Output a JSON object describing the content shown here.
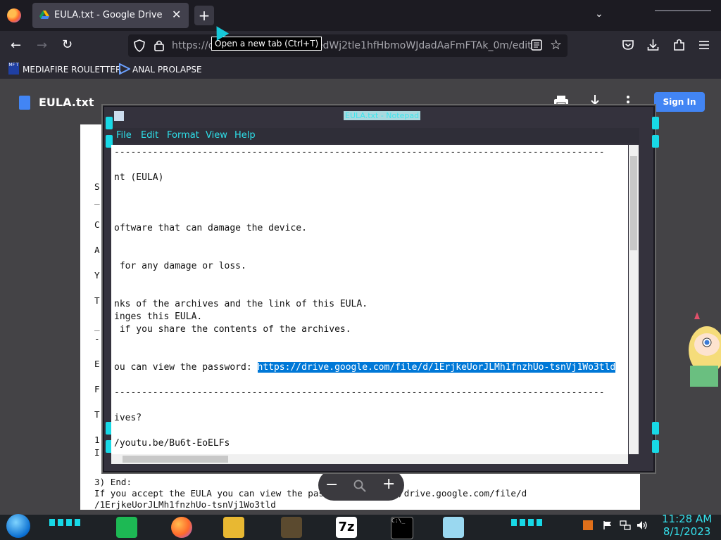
{
  "browser": {
    "tab_title": "EULA.txt - Google Drive",
    "tab_close": "✕",
    "new_tab": "+",
    "tabs_list": "⌄",
    "url_prefix": "https://d",
    "url_suffix": "5edWj2tle1hfHbmoWJdadAaFmFTAk_0m/edit",
    "tooltip": "Open a new tab (Ctrl+T)",
    "nav": {
      "back": "←",
      "forward": "→",
      "reload": "↻"
    },
    "bookmarks": [
      {
        "badge": "MF T",
        "label": "MEDIAFIRE ROULETTER"
      },
      {
        "badge": "",
        "label": "ANAL PROLAPSE"
      }
    ]
  },
  "drive": {
    "file_title": "EULA.txt",
    "sign_in": "Sign In",
    "zoom": {
      "minus": "−",
      "plus": "+"
    },
    "paper_lines": [
      "If you accept the EULA you can view the password: https://drive.google.com/file/d",
      "/1ErjkeUorJLMh1fnzhUo-tsnVj1Wo3tld"
    ],
    "paper_heading": "3) End:",
    "left_edge_chars": [
      "S",
      "_",
      "-",
      "C",
      "A",
      "Y",
      "T",
      "_",
      "-",
      "E",
      "F",
      "T",
      "1",
      "I"
    ]
  },
  "notepad": {
    "title": "EULA.txt - Notepad",
    "menu": [
      "File",
      "Edit",
      "Format",
      "View",
      "Help"
    ],
    "lines": [
      "-----------------------------------------------------------------------------------------",
      "",
      "nt (EULA)",
      "",
      "",
      "",
      "oftware that can damage the device.",
      "",
      "",
      " for any damage or loss.",
      "",
      "",
      "nks of the archives and the link of this EULA.",
      "inges this EULA.",
      " if you share the contents of the archives.",
      "",
      "",
      "ou can view the password: ",
      "",
      "-----------------------------------------------------------------------------------------",
      "",
      "ives?",
      "",
      "/youtu.be/Bu6t-EoELFs"
    ],
    "selected_link": "https://drive.google.com/file/d/1ErjkeUorJLMh1fnzhUo-tsnVj1Wo3tld"
  },
  "taskbar": {
    "clock_time": "11:28 AM",
    "clock_date": "8/1/2023",
    "seven_zip": "7z",
    "cmd": "C:\\_"
  }
}
